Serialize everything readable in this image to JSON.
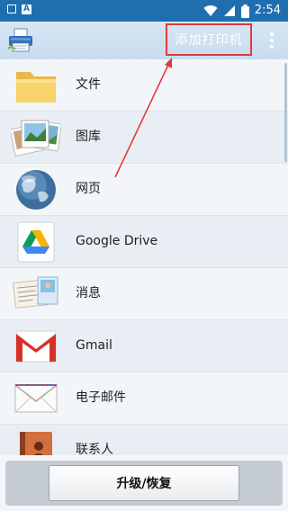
{
  "status_bar": {
    "time": "2:54",
    "icons": [
      "notification-square-icon",
      "a-badge-icon",
      "wifi-icon",
      "signal-icon",
      "battery-icon"
    ]
  },
  "app_bar": {
    "logo_icon": "printer-logo-icon",
    "add_printer_label": "添加打印机",
    "menu_icon": "overflow-menu-icon",
    "colors": {
      "bar": "#c8dbee",
      "status": "#1f6fb0",
      "highlight": "#e23b3b"
    }
  },
  "list": {
    "items": [
      {
        "label": "文件",
        "icon": "folder-icon"
      },
      {
        "label": "图库",
        "icon": "photos-icon"
      },
      {
        "label": "网页",
        "icon": "globe-icon"
      },
      {
        "label": "Google Drive",
        "icon": "google-drive-icon"
      },
      {
        "label": "消息",
        "icon": "postcard-icon"
      },
      {
        "label": "Gmail",
        "icon": "gmail-icon"
      },
      {
        "label": "电子邮件",
        "icon": "envelope-icon"
      },
      {
        "label": "联系人",
        "icon": "contacts-book-icon"
      }
    ]
  },
  "bottom": {
    "upgrade_label": "升级/恢复"
  }
}
